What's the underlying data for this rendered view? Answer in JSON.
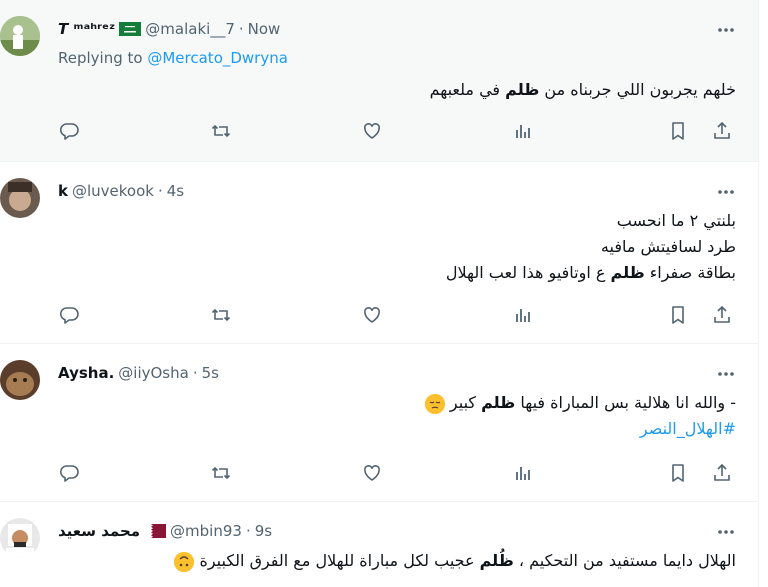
{
  "tweets": [
    {
      "name": "𝙏 ᵐᵃʰʳᵉᶻ",
      "flag": "saudi-arabia-flag",
      "handle": "@malaki__7",
      "sep": "·",
      "time": "Now",
      "replying_prefix": "Replying to",
      "replying_to": "@Mercato_Dwryna",
      "lines": [
        {
          "before": "خلهم يجربون اللي جربناه من ",
          "bold": "ظلم",
          "after": " في ملعبهم"
        }
      ]
    },
    {
      "name": "k",
      "handle": "@luvekook",
      "sep": "·",
      "time": "4s",
      "lines": [
        {
          "before": "بلنتي ٢ ما انحسب",
          "bold": "",
          "after": ""
        },
        {
          "before": "طرد لسافيتش مافيه",
          "bold": "",
          "after": ""
        },
        {
          "before": "بطاقة صفراء ",
          "bold": "ظلم",
          "after": " ع اوتافيو هذا لعب الهلال"
        }
      ]
    },
    {
      "name": "Aysha.",
      "handle": "@iiyOsha",
      "sep": "·",
      "time": "5s",
      "emoji": "pensive-face-emoji",
      "lines": [
        {
          "before": "- والله انا هلالية بس المباراة فيها ",
          "bold": "ظلم",
          "after": " كبير"
        }
      ],
      "hashtag": "#الهلال_النصر"
    },
    {
      "name": "محمد سعيد",
      "flag": "qatar-flag",
      "handle": "@mbin93",
      "sep": "·",
      "time": "9s",
      "emoji": "upside-down-face-emoji",
      "lines": [
        {
          "before": "الهلال دايما مستفيد من التحكيم ، ",
          "bold": "ظُلم",
          "after": " عجيب لكل مباراة للهلال مع الفرق الكبيرة"
        }
      ]
    }
  ],
  "colors": {
    "accent": "#1d9bf0",
    "muted": "#536471",
    "text": "#0f1419",
    "highlight_bg": "#f7f9f9"
  }
}
